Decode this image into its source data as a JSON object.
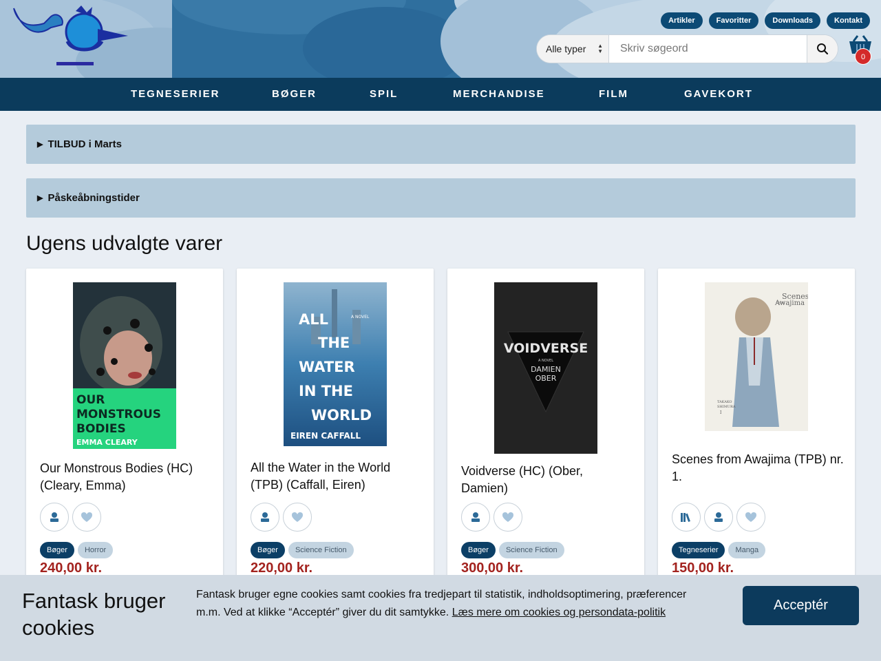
{
  "header": {
    "top_links": [
      "Artikler",
      "Favoritter",
      "Downloads",
      "Kontakt"
    ],
    "search": {
      "type_label": "Alle typer",
      "placeholder": "Skriv søgeord"
    },
    "basket_count": "0",
    "colors": {
      "sky": "#5d8fb8",
      "nav": "#0b3b5c",
      "pill": "#0c4a75",
      "badge": "#d42a2a"
    }
  },
  "nav": [
    "TEGNESERIER",
    "BØGER",
    "SPIL",
    "MERCHANDISE",
    "FILM",
    "GAVEKORT"
  ],
  "accordions": [
    "TILBUD i Marts",
    "Påskeåbningstider"
  ],
  "section_title": "Ugens udvalgte varer",
  "products": [
    {
      "title": "Our Monstrous Bodies (HC) (Cleary, Emma)",
      "cover_text": [
        "OUR",
        "MONSTROUS",
        "BODIES",
        "EMMA CLEARY"
      ],
      "tags": [
        "Bøger",
        "Horror"
      ],
      "price": "240,00 kr."
    },
    {
      "title": "All the Water in the World (TPB) (Caffall, Eiren)",
      "cover_text": [
        "ALL",
        "THE",
        "WATER",
        "IN THE",
        "WORLD",
        "EIREN CAFFALL",
        "A NOVEL"
      ],
      "tags": [
        "Bøger",
        "Science Fiction"
      ],
      "price": "220,00 kr."
    },
    {
      "title": "Voidverse (HC) (Ober, Damien)",
      "cover_text": [
        "VOIDVERSE",
        "A NOVEL",
        "DAMIEN",
        "OBER"
      ],
      "tags": [
        "Bøger",
        "Science Fiction"
      ],
      "price": "300,00 kr."
    },
    {
      "title": "Scenes from Awajima (TPB) nr. 1.",
      "cover_text": [
        "Scenes",
        "from",
        "Awajima",
        "TAKAKO",
        "SHIMURA",
        "I"
      ],
      "tags": [
        "Tegneserier",
        "Manga"
      ],
      "price": "150,00 kr."
    }
  ],
  "cookie": {
    "title": "Fantask bruger cookies",
    "text": "Fantask bruger egne cookies samt cookies fra tredjepart til statistik, indholdsoptimering, præferencer m.m. Ved at klikke “Acceptér” giver du dit samtykke. ",
    "link": "Læs mere om cookies og persondata-politik",
    "accept": "Acceptér"
  }
}
